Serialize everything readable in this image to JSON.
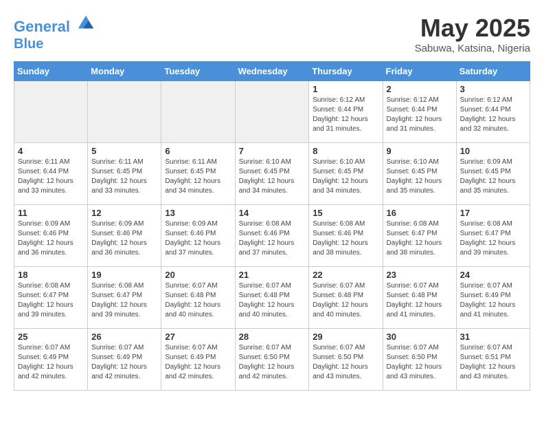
{
  "header": {
    "logo_line1": "General",
    "logo_line2": "Blue",
    "month": "May 2025",
    "location": "Sabuwa, Katsina, Nigeria"
  },
  "weekdays": [
    "Sunday",
    "Monday",
    "Tuesday",
    "Wednesday",
    "Thursday",
    "Friday",
    "Saturday"
  ],
  "weeks": [
    [
      {
        "day": "",
        "info": "",
        "shaded": true
      },
      {
        "day": "",
        "info": "",
        "shaded": true
      },
      {
        "day": "",
        "info": "",
        "shaded": true
      },
      {
        "day": "",
        "info": "",
        "shaded": true
      },
      {
        "day": "1",
        "info": "Sunrise: 6:12 AM\nSunset: 6:44 PM\nDaylight: 12 hours\nand 31 minutes."
      },
      {
        "day": "2",
        "info": "Sunrise: 6:12 AM\nSunset: 6:44 PM\nDaylight: 12 hours\nand 31 minutes."
      },
      {
        "day": "3",
        "info": "Sunrise: 6:12 AM\nSunset: 6:44 PM\nDaylight: 12 hours\nand 32 minutes."
      }
    ],
    [
      {
        "day": "4",
        "info": "Sunrise: 6:11 AM\nSunset: 6:44 PM\nDaylight: 12 hours\nand 33 minutes."
      },
      {
        "day": "5",
        "info": "Sunrise: 6:11 AM\nSunset: 6:45 PM\nDaylight: 12 hours\nand 33 minutes."
      },
      {
        "day": "6",
        "info": "Sunrise: 6:11 AM\nSunset: 6:45 PM\nDaylight: 12 hours\nand 34 minutes."
      },
      {
        "day": "7",
        "info": "Sunrise: 6:10 AM\nSunset: 6:45 PM\nDaylight: 12 hours\nand 34 minutes."
      },
      {
        "day": "8",
        "info": "Sunrise: 6:10 AM\nSunset: 6:45 PM\nDaylight: 12 hours\nand 34 minutes."
      },
      {
        "day": "9",
        "info": "Sunrise: 6:10 AM\nSunset: 6:45 PM\nDaylight: 12 hours\nand 35 minutes."
      },
      {
        "day": "10",
        "info": "Sunrise: 6:09 AM\nSunset: 6:45 PM\nDaylight: 12 hours\nand 35 minutes."
      }
    ],
    [
      {
        "day": "11",
        "info": "Sunrise: 6:09 AM\nSunset: 6:46 PM\nDaylight: 12 hours\nand 36 minutes."
      },
      {
        "day": "12",
        "info": "Sunrise: 6:09 AM\nSunset: 6:46 PM\nDaylight: 12 hours\nand 36 minutes."
      },
      {
        "day": "13",
        "info": "Sunrise: 6:09 AM\nSunset: 6:46 PM\nDaylight: 12 hours\nand 37 minutes."
      },
      {
        "day": "14",
        "info": "Sunrise: 6:08 AM\nSunset: 6:46 PM\nDaylight: 12 hours\nand 37 minutes."
      },
      {
        "day": "15",
        "info": "Sunrise: 6:08 AM\nSunset: 6:46 PM\nDaylight: 12 hours\nand 38 minutes."
      },
      {
        "day": "16",
        "info": "Sunrise: 6:08 AM\nSunset: 6:47 PM\nDaylight: 12 hours\nand 38 minutes."
      },
      {
        "day": "17",
        "info": "Sunrise: 6:08 AM\nSunset: 6:47 PM\nDaylight: 12 hours\nand 39 minutes."
      }
    ],
    [
      {
        "day": "18",
        "info": "Sunrise: 6:08 AM\nSunset: 6:47 PM\nDaylight: 12 hours\nand 39 minutes."
      },
      {
        "day": "19",
        "info": "Sunrise: 6:08 AM\nSunset: 6:47 PM\nDaylight: 12 hours\nand 39 minutes."
      },
      {
        "day": "20",
        "info": "Sunrise: 6:07 AM\nSunset: 6:48 PM\nDaylight: 12 hours\nand 40 minutes."
      },
      {
        "day": "21",
        "info": "Sunrise: 6:07 AM\nSunset: 6:48 PM\nDaylight: 12 hours\nand 40 minutes."
      },
      {
        "day": "22",
        "info": "Sunrise: 6:07 AM\nSunset: 6:48 PM\nDaylight: 12 hours\nand 40 minutes."
      },
      {
        "day": "23",
        "info": "Sunrise: 6:07 AM\nSunset: 6:48 PM\nDaylight: 12 hours\nand 41 minutes."
      },
      {
        "day": "24",
        "info": "Sunrise: 6:07 AM\nSunset: 6:49 PM\nDaylight: 12 hours\nand 41 minutes."
      }
    ],
    [
      {
        "day": "25",
        "info": "Sunrise: 6:07 AM\nSunset: 6:49 PM\nDaylight: 12 hours\nand 42 minutes."
      },
      {
        "day": "26",
        "info": "Sunrise: 6:07 AM\nSunset: 6:49 PM\nDaylight: 12 hours\nand 42 minutes."
      },
      {
        "day": "27",
        "info": "Sunrise: 6:07 AM\nSunset: 6:49 PM\nDaylight: 12 hours\nand 42 minutes."
      },
      {
        "day": "28",
        "info": "Sunrise: 6:07 AM\nSunset: 6:50 PM\nDaylight: 12 hours\nand 42 minutes."
      },
      {
        "day": "29",
        "info": "Sunrise: 6:07 AM\nSunset: 6:50 PM\nDaylight: 12 hours\nand 43 minutes."
      },
      {
        "day": "30",
        "info": "Sunrise: 6:07 AM\nSunset: 6:50 PM\nDaylight: 12 hours\nand 43 minutes."
      },
      {
        "day": "31",
        "info": "Sunrise: 6:07 AM\nSunset: 6:51 PM\nDaylight: 12 hours\nand 43 minutes."
      }
    ]
  ]
}
